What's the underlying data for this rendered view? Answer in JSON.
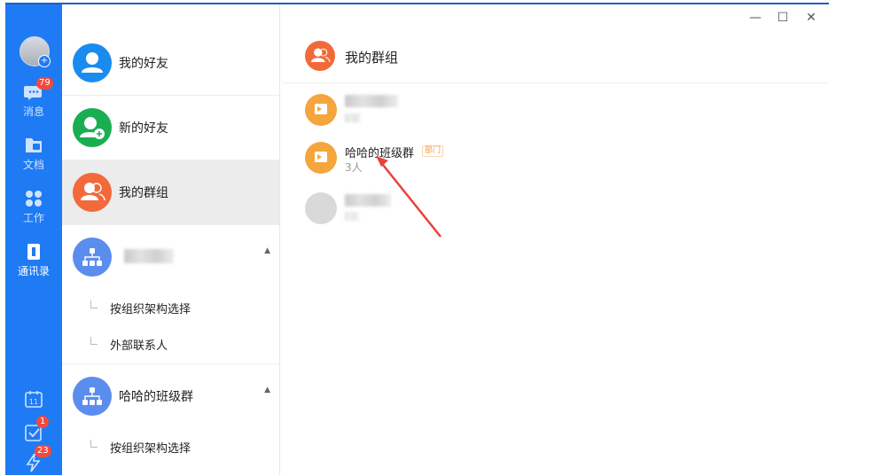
{
  "window": {
    "minimize": "—",
    "maximize": "☐",
    "close": "✕"
  },
  "rail": {
    "items": [
      {
        "label": "消息",
        "badge": "79",
        "icon": "chat-icon"
      },
      {
        "label": "文档",
        "icon": "folder-icon"
      },
      {
        "label": "工作",
        "icon": "apps-icon"
      },
      {
        "label": "通讯录",
        "icon": "contacts-icon",
        "active": true
      }
    ],
    "bottom": [
      {
        "icon": "calendar-icon",
        "text": "11"
      },
      {
        "icon": "task-check-icon",
        "badge": "1"
      },
      {
        "icon": "lightning-icon",
        "badge": "23"
      }
    ]
  },
  "contacts": {
    "my_friends": "我的好友",
    "new_friends": "新的好友",
    "my_groups": "我的群组",
    "org1": {
      "sub1": "按组织架构选择",
      "sub2": "外部联系人"
    },
    "org2": {
      "name": "哈哈的班级群",
      "sub1": "按组织架构选择"
    }
  },
  "main": {
    "title": "我的群组",
    "groups": [
      {
        "name": "哈哈的班级群",
        "count": "3人",
        "tag": "部门"
      }
    ]
  },
  "colors": {
    "rail": "#1e7bf4",
    "friends": "#1a8cf0",
    "new_friends": "#1aad52",
    "groups": "#f26a3b",
    "org": "#5b8def"
  }
}
